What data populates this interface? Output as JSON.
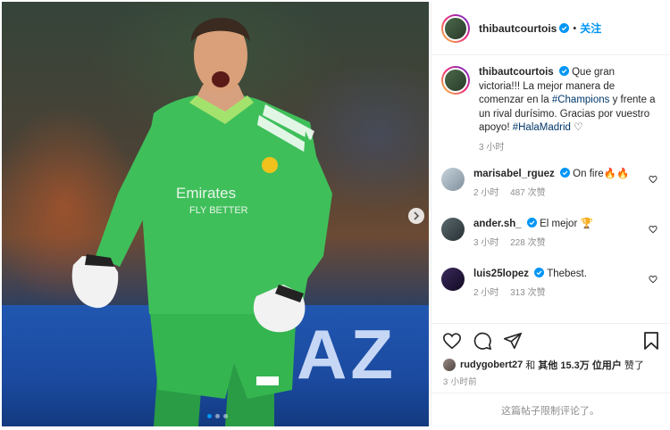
{
  "post": {
    "username": "thibautcourtois",
    "follow_label": "关注",
    "separator": "•",
    "caption": {
      "username": "thibautcourtois",
      "text_1": "Que gran victoria!!! La mejor manera de comenzar en la",
      "hashtag_1": "#Champions",
      "text_2": "y frente a un rival durísimo. Gracias por vuestro apoyo!",
      "hashtag_2": "#HalaMadrid",
      "emoji": "♡",
      "time": "3 小时"
    },
    "comments": [
      {
        "username": "marisabel_rguez",
        "text": "On fire🔥🔥",
        "time": "2 小时",
        "likes": "487 次赞"
      },
      {
        "username": "ander.sh_",
        "text": "El mejor 🏆",
        "time": "3 小时",
        "likes": "228 次赞"
      },
      {
        "username": "luis25lopez",
        "text": "Thebest.",
        "time": "2 小时",
        "likes": "313 次赞"
      }
    ],
    "likes": {
      "liker": "rudygobert27",
      "joiner": "和",
      "others": "其他 15.3万 位用户",
      "suffix": "赞了"
    },
    "posted": "3 小时前",
    "comments_closed": "这篇帖子限制评论了。"
  },
  "photo": {
    "board_text": "AZ",
    "jersey_sponsor_1": "Emirates",
    "jersey_sponsor_2": "FLY BETTER"
  },
  "icons": {
    "verified": "verified-icon",
    "heart": "heart-icon",
    "comment": "comment-icon",
    "share": "share-icon",
    "bookmark": "bookmark-icon",
    "next": "chevron-right-icon"
  },
  "colors": {
    "accent": "#0095f6",
    "hashtag": "#00376b",
    "muted": "#8e8e8e",
    "jersey": "#3fbf5a"
  }
}
